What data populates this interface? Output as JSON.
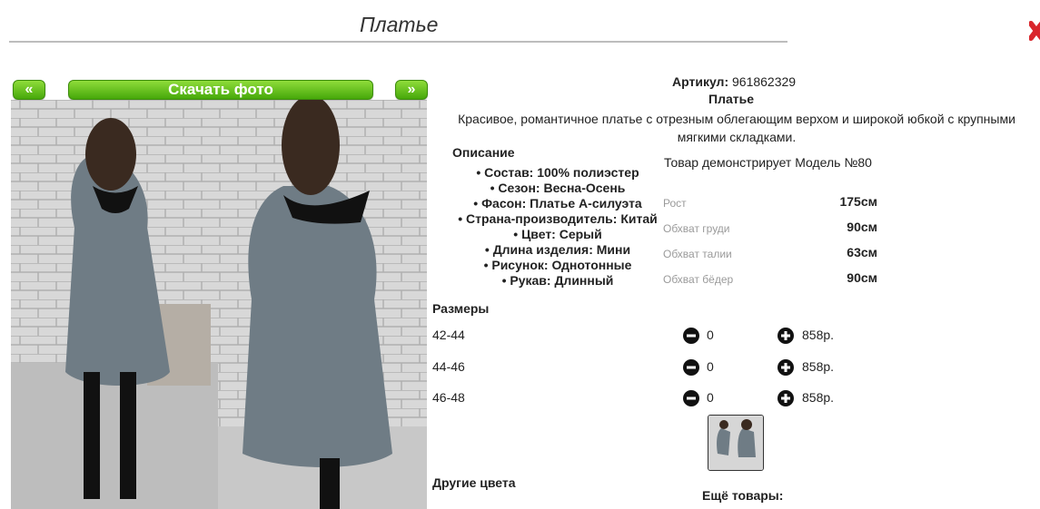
{
  "page": {
    "title": "Платье"
  },
  "gallery": {
    "prev_label": "«",
    "next_label": "»",
    "download_label": "Скачать фото"
  },
  "product": {
    "article_label": "Артикул:",
    "article_value": "961862329",
    "name": "Платье",
    "description": "Красивое, романтичное платье с отрезным облегающим верхом и широкой юбкой с крупными мягкими складками.",
    "description_heading": "Описание",
    "properties": [
      "Состав: 100% полиэстер",
      "Сезон: Весна-Осень",
      "Фасон: Платье А-силуэта",
      "Страна-производитель: Китай",
      "Цвет: Серый",
      "Длина изделия: Мини",
      "Рисунок: Однотонные",
      "Рукав: Длинный"
    ]
  },
  "model": {
    "heading": "Товар демонстрирует Модель №80",
    "measurements": [
      {
        "label": "Рост",
        "value": "175см"
      },
      {
        "label": "Обхват груди",
        "value": "90см"
      },
      {
        "label": "Обхват талии",
        "value": "63см"
      },
      {
        "label": "Обхват бёдер",
        "value": "90см"
      }
    ]
  },
  "sizes": {
    "heading": "Размеры",
    "rows": [
      {
        "size": "42-44",
        "qty": "0",
        "price": "858р."
      },
      {
        "size": "44-46",
        "qty": "0",
        "price": "858р."
      },
      {
        "size": "46-48",
        "qty": "0",
        "price": "858р."
      }
    ]
  },
  "footer": {
    "other_colors": "Другие цвета",
    "more_goods": "Ещё товары:"
  },
  "icons": {
    "close": "close-icon",
    "minus": "minus-circle-icon",
    "plus": "plus-circle-icon"
  },
  "colors": {
    "button_green": "#5cbf14",
    "close_red": "#d9262c",
    "dress_gray": "#6f7c85"
  }
}
